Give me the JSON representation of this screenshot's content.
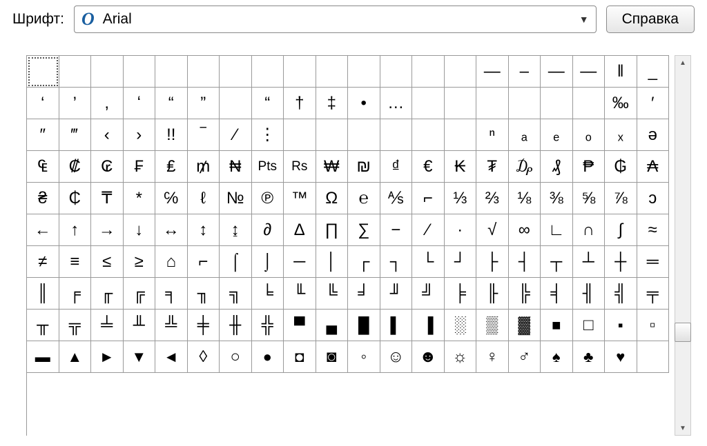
{
  "toolbar": {
    "font_label": "Шрифт:",
    "font_icon": "O",
    "font_name": "Arial",
    "help_label": "Справка"
  },
  "chart_data": {
    "type": "table",
    "title": "Character map grid",
    "rows": [
      [
        "",
        "",
        "",
        "",
        "",
        "",
        "",
        "",
        "",
        "",
        "",
        "",
        "",
        "",
        "—",
        "–",
        "—",
        "—",
        "‖",
        "_"
      ],
      [
        "‘",
        "’",
        ",",
        "ʻ",
        "“",
        "”",
        "",
        "“",
        "†",
        "‡",
        "•",
        "…",
        "",
        "",
        "",
        "",
        "",
        "",
        "‰",
        "′"
      ],
      [
        "″",
        "‴",
        "‹",
        "›",
        "!!",
        "‾",
        "⁄",
        "⋮",
        "",
        "",
        "",
        "",
        "",
        "",
        "ⁿ",
        "ₐ",
        "ₑ",
        "ₒ",
        "ₓ",
        "ə"
      ],
      [
        "₠",
        "₡",
        "₢",
        "₣",
        "₤",
        "₥",
        "₦",
        "Pts",
        "Rs",
        "₩",
        "₪",
        "₫",
        "€",
        "₭",
        "₮",
        "₯",
        "₰",
        "₱",
        "₲",
        "₳"
      ],
      [
        "₴",
        "₵",
        "₸",
        "*",
        "℅",
        "ℓ",
        "№",
        "℗",
        "™",
        "Ω",
        "℮",
        "⅍",
        "⌐",
        "⅓",
        "⅔",
        "⅛",
        "⅜",
        "⅝",
        "⅞",
        "ↄ"
      ],
      [
        "←",
        "↑",
        "→",
        "↓",
        "↔",
        "↕",
        "↨",
        "∂",
        "∆",
        "∏",
        "∑",
        "−",
        "∕",
        "∙",
        "√",
        "∞",
        "∟",
        "∩",
        "∫",
        "≈"
      ],
      [
        "≠",
        "≡",
        "≤",
        "≥",
        "⌂",
        "⌐",
        "⌠",
        "⌡",
        "─",
        "│",
        "┌",
        "┐",
        "└",
        "┘",
        "├",
        "┤",
        "┬",
        "┴",
        "┼",
        "═"
      ],
      [
        "║",
        "╒",
        "╓",
        "╔",
        "╕",
        "╖",
        "╗",
        "╘",
        "╙",
        "╚",
        "╛",
        "╜",
        "╝",
        "╞",
        "╟",
        "╠",
        "╡",
        "╢",
        "╣",
        "╤"
      ],
      [
        "╥",
        "╦",
        "╧",
        "╨",
        "╩",
        "╪",
        "╫",
        "╬",
        "▀",
        "▄",
        "█",
        "▌",
        "▐",
        "░",
        "▒",
        "▓",
        "■",
        "□",
        "▪",
        "▫"
      ],
      [
        "▬",
        "▲",
        "►",
        "▼",
        "◄",
        "◊",
        "○",
        "●",
        "◘",
        "◙",
        "◦",
        "☺",
        "☻",
        "☼",
        "♀",
        "♂",
        "♠",
        "♣",
        "♥",
        ""
      ]
    ],
    "selected": [
      0,
      0
    ]
  }
}
